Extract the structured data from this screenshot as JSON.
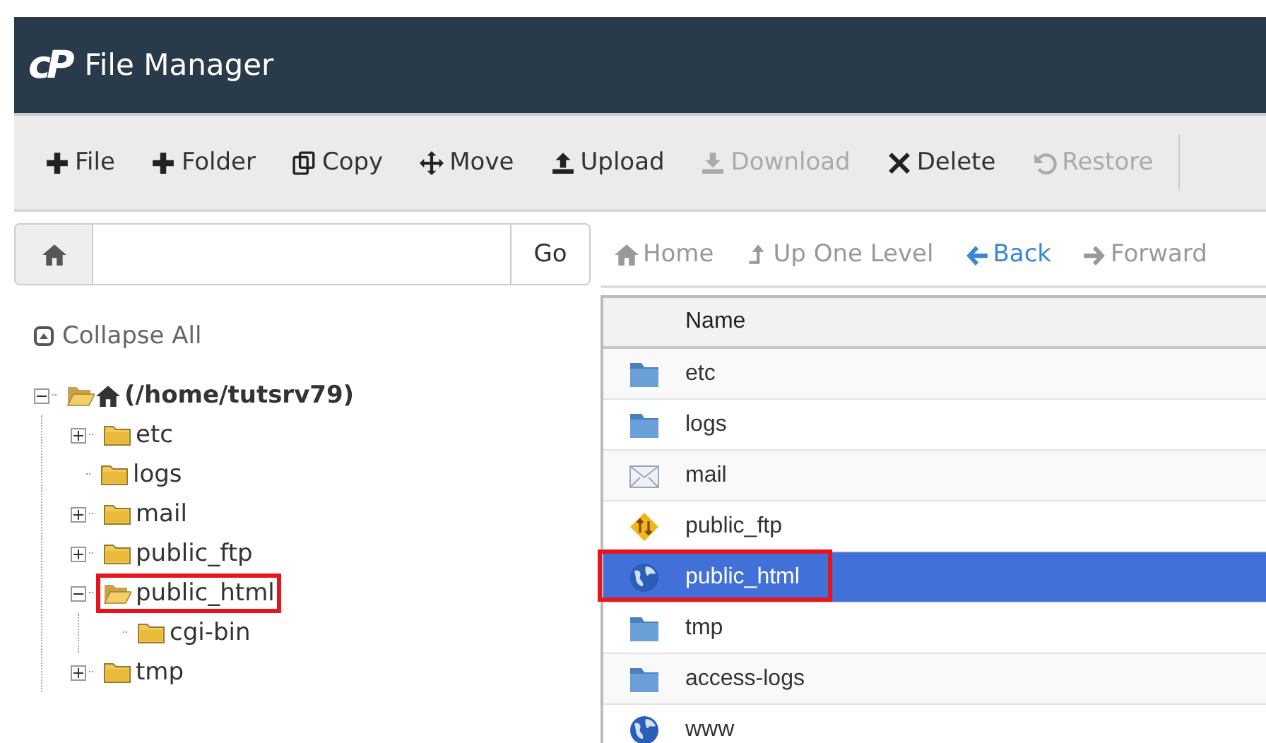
{
  "header": {
    "title": "File Manager",
    "logo": "cP"
  },
  "toolbar": [
    {
      "label": "File",
      "kind": "plus",
      "disabled": false
    },
    {
      "label": "Folder",
      "kind": "plus",
      "disabled": false
    },
    {
      "label": "Copy",
      "kind": "copy",
      "disabled": false
    },
    {
      "label": "Move",
      "kind": "move",
      "disabled": false
    },
    {
      "label": "Upload",
      "kind": "upload",
      "disabled": false
    },
    {
      "label": "Download",
      "kind": "download",
      "disabled": true
    },
    {
      "label": "Delete",
      "kind": "cross",
      "disabled": false
    },
    {
      "label": "Restore",
      "kind": "undo",
      "disabled": true
    }
  ],
  "path_bar": {
    "button": "Go"
  },
  "nav": [
    {
      "label": "Home",
      "kind": "home",
      "disabled": true
    },
    {
      "label": "Up One Level",
      "kind": "up",
      "disabled": true
    },
    {
      "label": "Back",
      "kind": "left",
      "disabled": false
    },
    {
      "label": "Forward",
      "kind": "right",
      "disabled": true
    }
  ],
  "tree": {
    "collapse_all": "Collapse All",
    "root": {
      "label": "(/home/tutsrv79)",
      "expanded": true,
      "highlighted": false,
      "children": [
        {
          "label": "etc",
          "expanded": false,
          "highlighted": false
        },
        {
          "label": "logs",
          "highlighted": false
        },
        {
          "label": "mail",
          "expanded": false,
          "highlighted": false
        },
        {
          "label": "public_ftp",
          "expanded": false,
          "highlighted": false
        },
        {
          "label": "public_html",
          "expanded": true,
          "highlighted": true,
          "children": [
            {
              "label": "cgi-bin",
              "highlighted": false
            }
          ]
        },
        {
          "label": "tmp",
          "expanded": false,
          "highlighted": false
        }
      ]
    }
  },
  "files": {
    "columns": [
      "Name"
    ],
    "rows": [
      {
        "name": "etc",
        "kind": "folder",
        "selected": false,
        "highlighted": false
      },
      {
        "name": "logs",
        "kind": "folder",
        "selected": false,
        "highlighted": false
      },
      {
        "name": "mail",
        "kind": "mail",
        "selected": false,
        "highlighted": false
      },
      {
        "name": "public_ftp",
        "kind": "ftp",
        "selected": false,
        "highlighted": false
      },
      {
        "name": "public_html",
        "kind": "globe",
        "selected": true,
        "highlighted": true
      },
      {
        "name": "tmp",
        "kind": "folder",
        "selected": false,
        "highlighted": false
      },
      {
        "name": "access-logs",
        "kind": "folder",
        "selected": false,
        "highlighted": false
      },
      {
        "name": "www",
        "kind": "globe",
        "selected": false,
        "highlighted": false
      }
    ]
  }
}
